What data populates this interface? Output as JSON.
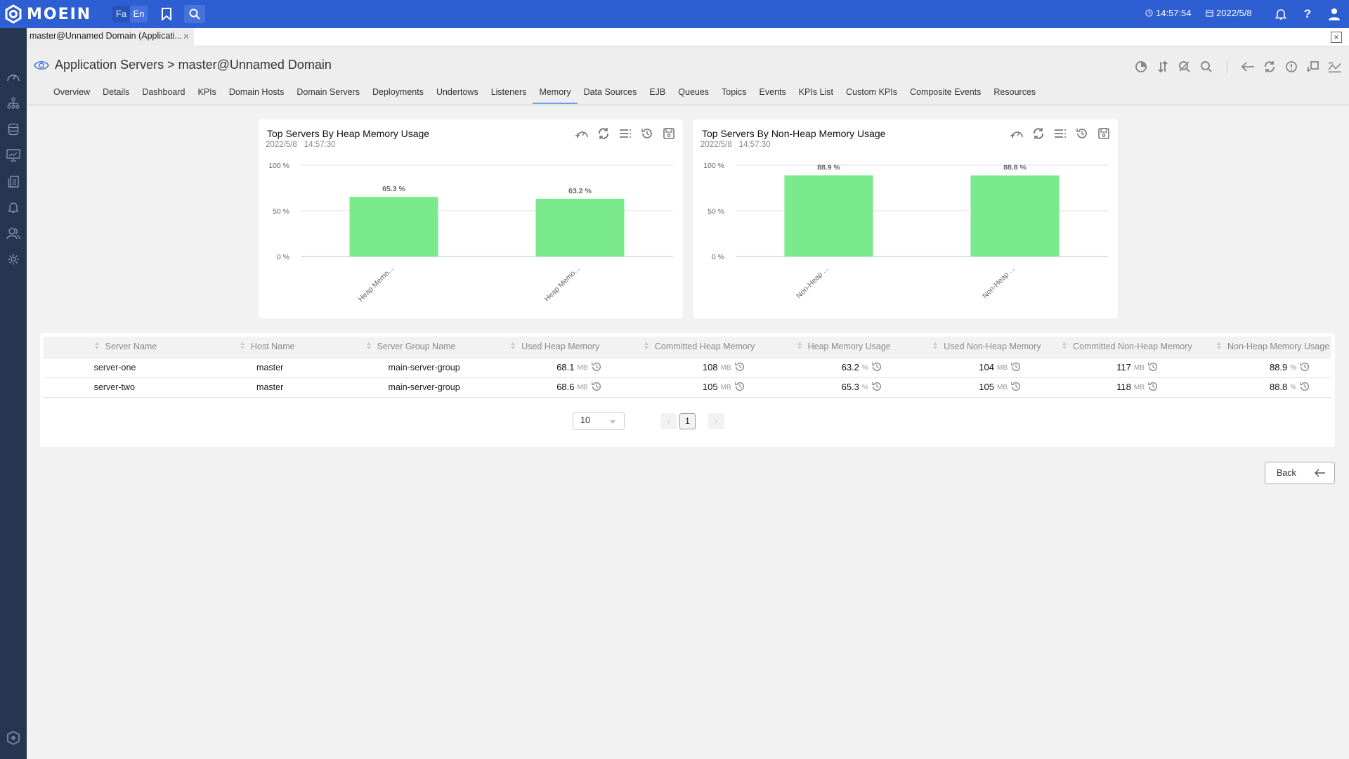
{
  "header": {
    "brand": "MOEIN",
    "languages": [
      "Fa",
      "En"
    ],
    "active_language": "En",
    "time": "14:57:54",
    "date": "2022/5/8",
    "help_label": "?",
    "colors": {
      "header_bg": "#2d5fd3",
      "sidebar_bg": "#263550",
      "bar_fill": "#7aea8c",
      "active_tab_underline": "#6aa0f0"
    }
  },
  "sidebar": {
    "items": [
      "dashboard-gauge",
      "topology",
      "database",
      "monitor-chart",
      "reports",
      "alerts",
      "users",
      "settings"
    ],
    "footer": "eye-shield"
  },
  "doc_tabs": [
    {
      "label": "master@Unnamed Domain (Applicati...",
      "active": true
    }
  ],
  "page": {
    "title": "Application Servers > master@Unnamed Domain",
    "tabs": [
      "Overview",
      "Details",
      "Dashboard",
      "KPIs",
      "Domain Hosts",
      "Domain Servers",
      "Deployments",
      "Undertows",
      "Listeners",
      "Memory",
      "Data Sources",
      "EJB",
      "Queues",
      "Topics",
      "Events",
      "KPIs List",
      "Custom KPIs",
      "Composite Events",
      "Resources"
    ],
    "active_tab": "Memory"
  },
  "chart_data": [
    {
      "type": "bar",
      "title": "Top Servers By Heap Memory Usage",
      "date": "2022/5/8",
      "time": "14:57:30",
      "categories": [
        "Heap Memo...",
        "Heap Memo..."
      ],
      "values": [
        65.3,
        63.2
      ],
      "value_labels": [
        "65.3 %",
        "63.2 %"
      ],
      "yticks": [
        "0 %",
        "50 %",
        "100 %"
      ],
      "ylim": [
        0,
        100
      ],
      "xlabel": "",
      "ylabel": "",
      "grid": true
    },
    {
      "type": "bar",
      "title": "Top Servers By Non-Heap Memory Usage",
      "date": "2022/5/8",
      "time": "14:57:30",
      "categories": [
        "Non-Heap ...",
        "Non-Heap ..."
      ],
      "values": [
        88.9,
        88.8
      ],
      "value_labels": [
        "88.9 %",
        "88.8 %"
      ],
      "yticks": [
        "0 %",
        "50 %",
        "100 %"
      ],
      "ylim": [
        0,
        100
      ],
      "xlabel": "",
      "ylabel": "",
      "grid": true
    }
  ],
  "table": {
    "columns": [
      "Server Name",
      "Host Name",
      "Server Group Name",
      "Used Heap Memory",
      "Committed Heap Memory",
      "Heap Memory Usage",
      "Used Non-Heap Memory",
      "Committed Non-Heap Memory",
      "Non-Heap Memory Usage"
    ],
    "rows": [
      {
        "server": "server-one",
        "host": "master",
        "group": "main-server-group",
        "used_heap": "68.1",
        "committed_heap": "108",
        "heap_usage": "63.2",
        "used_nonheap": "104",
        "committed_nonheap": "117",
        "nonheap_usage": "88.9"
      },
      {
        "server": "server-two",
        "host": "master",
        "group": "main-server-group",
        "used_heap": "68.6",
        "committed_heap": "105",
        "heap_usage": "65.3",
        "used_nonheap": "105",
        "committed_nonheap": "118",
        "nonheap_usage": "88.8"
      }
    ],
    "units": {
      "mb": "MB",
      "pct": "%"
    },
    "page_size": "10",
    "current_page": "1"
  },
  "buttons": {
    "back": "Back"
  }
}
